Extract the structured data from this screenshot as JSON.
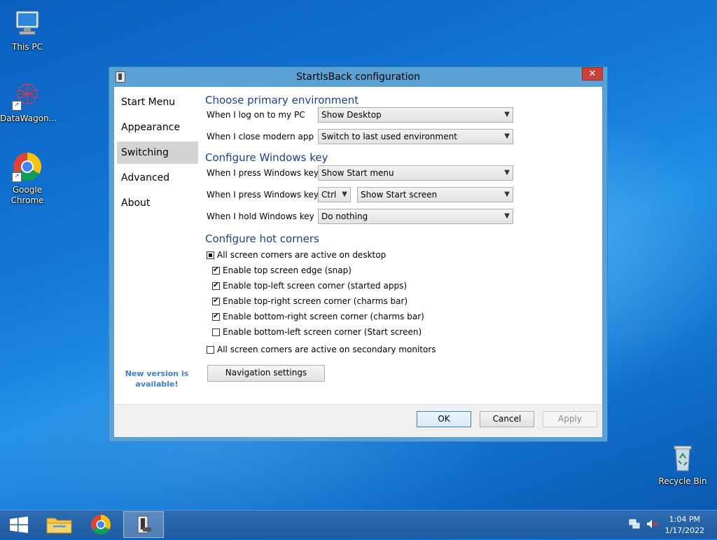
{
  "desktop": {
    "icons": [
      {
        "label": "This PC"
      },
      {
        "label": "DataWagon..."
      },
      {
        "label": "Google Chrome"
      },
      {
        "label": "Recycle Bin"
      }
    ]
  },
  "window": {
    "title": "StartIsBack configuration",
    "close_glyph": "✕",
    "nav": [
      "Start Menu",
      "Appearance",
      "Switching",
      "Advanced",
      "About"
    ],
    "selected_nav": "Switching",
    "new_version": "New version is available!",
    "sections": {
      "primary_env": {
        "title": "Choose primary environment",
        "rows": [
          {
            "label": "When I log on to my PC",
            "value": "Show Desktop"
          },
          {
            "label": "When I close modern app",
            "value": "Switch to last used environment"
          }
        ]
      },
      "windows_key": {
        "title": "Configure Windows key",
        "rows": [
          {
            "label": "When I press Windows key",
            "value": "Show Start menu"
          },
          {
            "label": "When I press Windows key +",
            "modifier": "Ctrl",
            "value": "Show Start screen"
          },
          {
            "label": "When I hold Windows key",
            "value": "Do nothing"
          }
        ]
      },
      "hot_corners": {
        "title": "Configure hot corners",
        "all_desktop": {
          "label": "All screen corners are active on desktop",
          "state": "mixed"
        },
        "items": [
          {
            "label": "Enable top screen edge (snap)",
            "checked": true
          },
          {
            "label": "Enable top-left screen corner (started apps)",
            "checked": true
          },
          {
            "label": "Enable top-right screen corner (charms bar)",
            "checked": true
          },
          {
            "label": "Enable bottom-right screen corner (charms bar)",
            "checked": true
          },
          {
            "label": "Enable bottom-left screen corner (Start screen)",
            "checked": false
          }
        ],
        "secondary": {
          "label": "All screen corners are active on secondary monitors",
          "checked": false
        }
      }
    },
    "nav_settings_button": "Navigation settings",
    "buttons": {
      "ok": "OK",
      "cancel": "Cancel",
      "apply": "Apply"
    }
  },
  "taskbar": {
    "time": "1:04 PM",
    "date": "1/17/2022"
  }
}
